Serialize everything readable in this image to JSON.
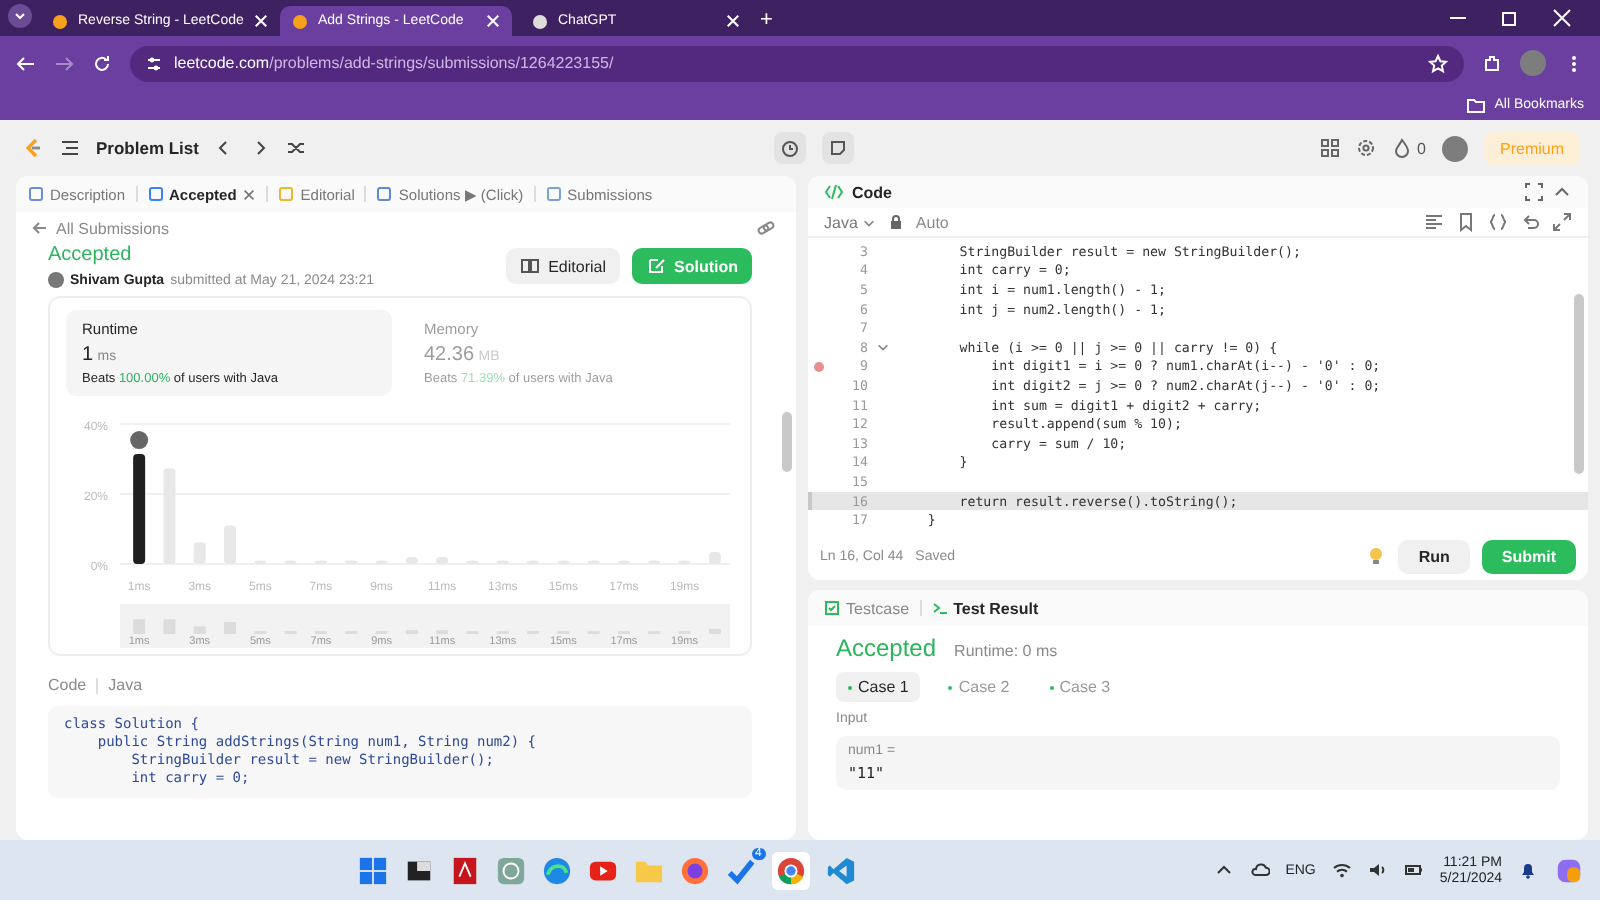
{
  "browser": {
    "tabs": [
      {
        "title": "Reverse String - LeetCode",
        "selected": false
      },
      {
        "title": "Add Strings - LeetCode",
        "selected": true
      },
      {
        "title": "ChatGPT",
        "selected": false
      }
    ],
    "new_tab": "+",
    "url": {
      "host": "leetcode.com",
      "path": "/problems/add-strings/submissions/1264223155/"
    },
    "bookmarks": "All Bookmarks"
  },
  "header": {
    "problem_list": "Problem List",
    "streak": "0",
    "premium": "Premium"
  },
  "left_tabs": [
    {
      "label": "Description",
      "selected": false,
      "closable": false
    },
    {
      "label": "Accepted",
      "selected": true,
      "closable": true
    },
    {
      "label": "Editorial",
      "selected": false,
      "closable": false
    },
    {
      "label": "Solutions ▶ (Click)",
      "selected": false,
      "closable": false
    },
    {
      "label": "Submissions",
      "selected": false,
      "closable": false
    }
  ],
  "submission": {
    "back": "All Submissions",
    "status": "Accepted",
    "author": "Shivam Gupta",
    "submitted": "submitted at May 21, 2024 23:21",
    "editorial": "Editorial",
    "solution": "Solution",
    "stats": [
      {
        "label": "Runtime",
        "value": "1",
        "unit": "ms",
        "beats": "Beats",
        "percent": "100.00%",
        "suffix": "of users with Java",
        "selected": true
      },
      {
        "label": "Memory",
        "value": "42.36",
        "unit": "MB",
        "beats": "Beats",
        "percent": "71.39%",
        "suffix": "of users with Java",
        "selected": false
      }
    ],
    "chart_data": {
      "type": "bar",
      "x": [
        1,
        2,
        3,
        4,
        5,
        6,
        7,
        8,
        9,
        10,
        11,
        12,
        13,
        14,
        15,
        16,
        17,
        18,
        19,
        20
      ],
      "values": [
        31.4,
        27.3,
        6.2,
        11,
        1,
        1,
        1,
        1,
        1,
        2,
        2,
        1,
        1,
        1,
        1,
        1,
        1,
        1,
        1,
        3.4
      ],
      "ylim": [
        0,
        40
      ],
      "yticks": [
        {
          "value": 0,
          "label": "0%"
        },
        {
          "value": 20,
          "label": "20%"
        },
        {
          "value": 40,
          "label": "40%"
        }
      ],
      "xticks": [
        {
          "value": 1,
          "label": "1ms"
        },
        {
          "value": 3,
          "label": "3ms"
        },
        {
          "value": 5,
          "label": "5ms"
        },
        {
          "value": 7,
          "label": "7ms"
        },
        {
          "value": 9,
          "label": "9ms"
        },
        {
          "value": 11,
          "label": "11ms"
        },
        {
          "value": 13,
          "label": "13ms"
        },
        {
          "value": 15,
          "label": "15ms"
        },
        {
          "value": 17,
          "label": "17ms"
        },
        {
          "value": 19,
          "label": "19ms"
        }
      ],
      "xlim": [
        0.5,
        20.5
      ]
    },
    "overview_labels": [
      "1ms",
      "3ms",
      "5ms",
      "7ms",
      "9ms",
      "11ms",
      "13ms",
      "15ms",
      "17ms",
      "19ms"
    ],
    "code_label": "Code",
    "code_language": "Java",
    "code": [
      "class Solution {",
      "    public String addStrings(String num1, String num2) {",
      "        StringBuilder result = new StringBuilder();",
      "        int carry = 0;"
    ]
  },
  "editor": {
    "title": "Code",
    "language": "Java",
    "mode": "Auto",
    "lines": [
      {
        "n": "3",
        "text": "        StringBuilder result = new StringBuilder();",
        "selected": false,
        "breakpoint": false,
        "foldable": false
      },
      {
        "n": "4",
        "text": "        int carry = 0;",
        "selected": false,
        "breakpoint": false,
        "foldable": false
      },
      {
        "n": "5",
        "text": "        int i = num1.length() - 1;",
        "selected": false,
        "breakpoint": false,
        "foldable": false
      },
      {
        "n": "6",
        "text": "        int j = num2.length() - 1;",
        "selected": false,
        "breakpoint": false,
        "foldable": false
      },
      {
        "n": "7",
        "selected": false,
        "breakpoint": false,
        "foldable": false
      },
      {
        "n": "8",
        "text": "        while (i >= 0 || j >= 0 || carry != 0) {",
        "selected": false,
        "breakpoint": false,
        "foldable": true
      },
      {
        "n": "9",
        "text": "            int digit1 = i >= 0 ? num1.charAt(i--) - '0' : 0;",
        "selected": false,
        "breakpoint": true,
        "foldable": false
      },
      {
        "n": "10",
        "text": "            int digit2 = j >= 0 ? num2.charAt(j--) - '0' : 0;",
        "selected": false,
        "breakpoint": false,
        "foldable": false
      },
      {
        "n": "11",
        "text": "            int sum = digit1 + digit2 + carry;",
        "selected": false,
        "breakpoint": false,
        "foldable": false
      },
      {
        "n": "12",
        "text": "            result.append(sum % 10);",
        "selected": false,
        "breakpoint": false,
        "foldable": false
      },
      {
        "n": "13",
        "text": "            carry = sum / 10;",
        "selected": false,
        "breakpoint": false,
        "foldable": false
      },
      {
        "n": "14",
        "text": "        }",
        "selected": false,
        "breakpoint": false,
        "foldable": false
      },
      {
        "n": "15",
        "selected": false,
        "breakpoint": false,
        "foldable": false
      },
      {
        "n": "16",
        "text": "        return result.reverse().toString();",
        "selected": true,
        "breakpoint": false,
        "foldable": false
      },
      {
        "n": "17",
        "text": "    }",
        "selected": false,
        "breakpoint": false,
        "foldable": false
      }
    ],
    "position": "Ln 16, Col 44",
    "saved": "Saved",
    "run": "Run",
    "submit": "Submit"
  },
  "test": {
    "tabs": [
      {
        "label": "Testcase",
        "selected": false
      },
      {
        "label": "Test Result",
        "selected": true
      }
    ],
    "status": "Accepted",
    "runtime": "Runtime: 0 ms",
    "cases": [
      {
        "label": "Case 1",
        "selected": true
      },
      {
        "label": "Case 2",
        "selected": false
      },
      {
        "label": "Case 3",
        "selected": false
      }
    ],
    "input_label": "Input",
    "param": "num1 =",
    "value": "\"11\""
  },
  "taskbar": {
    "badge": "4",
    "language": "ENG",
    "time": "11:21 PM",
    "date": "5/21/2024"
  }
}
